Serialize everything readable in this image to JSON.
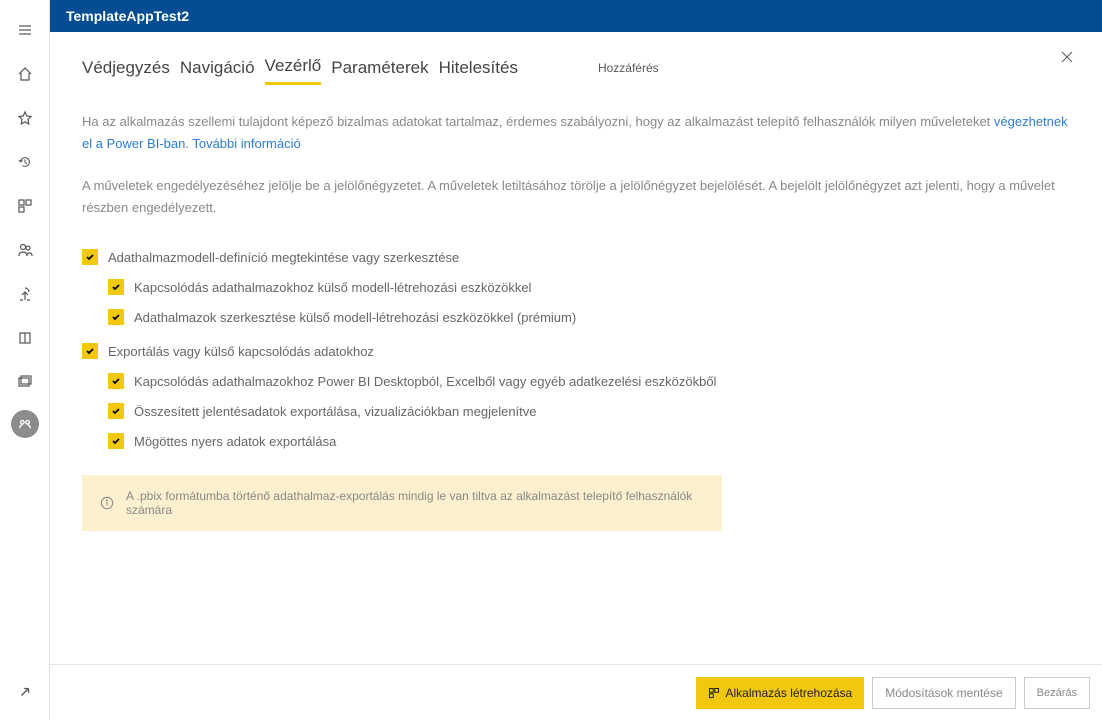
{
  "header": {
    "title": "TemplateAppTest2"
  },
  "tabs": {
    "items": [
      {
        "label": "Védjegyzés"
      },
      {
        "label": "Navigáció"
      },
      {
        "label": "Vezérlő"
      },
      {
        "label": "Paraméterek"
      },
      {
        "label": "Hitelesítés"
      }
    ],
    "right": "Hozzáférés"
  },
  "desc": {
    "part1": "Ha az alkalmazás szellemi tulajdont képező bizalmas adatokat tartalmaz, érdemes szabályozni, hogy az alkalmazást telepítő felhasználók milyen műveleteket ",
    "link1": "végezhetnek el a Power BI-ban.",
    "link2": "További információ"
  },
  "desc2": "A műveletek engedélyezéséhez jelölje be a jelölőnégyzetet. A műveletek letiltásához törölje a jelölőnégyzet bejelölését. A bejelölt jelölőnégyzet azt jelenti, hogy a művelet részben engedélyezett.",
  "checks": {
    "group1": {
      "main": "Adathalmazmodell-definíció megtekintése vagy szerkesztése",
      "sub1": "Kapcsolódás adathalmazokhoz külső modell-létrehozási eszközökkel",
      "sub2": "Adathalmazok szerkesztése külső modell-létrehozási eszközökkel (prémium)"
    },
    "group2": {
      "main": "Exportálás vagy külső kapcsolódás adatokhoz",
      "sub1": "Kapcsolódás adathalmazokhoz Power BI Desktopból, Excelből vagy egyéb adatkezelési eszközökből",
      "sub2": "Összesített jelentésadatok exportálása, vizualizációkban megjelenítve",
      "sub3": "Mögöttes nyers adatok exportálása"
    }
  },
  "banner": "A .pbix formátumba történő adathalmaz-exportálás mindig le van tiltva az alkalmazást telepítő felhasználók számára",
  "footer": {
    "create": "Alkalmazás létrehozása",
    "save": "Módosítások mentése",
    "close": "Bezárás"
  }
}
